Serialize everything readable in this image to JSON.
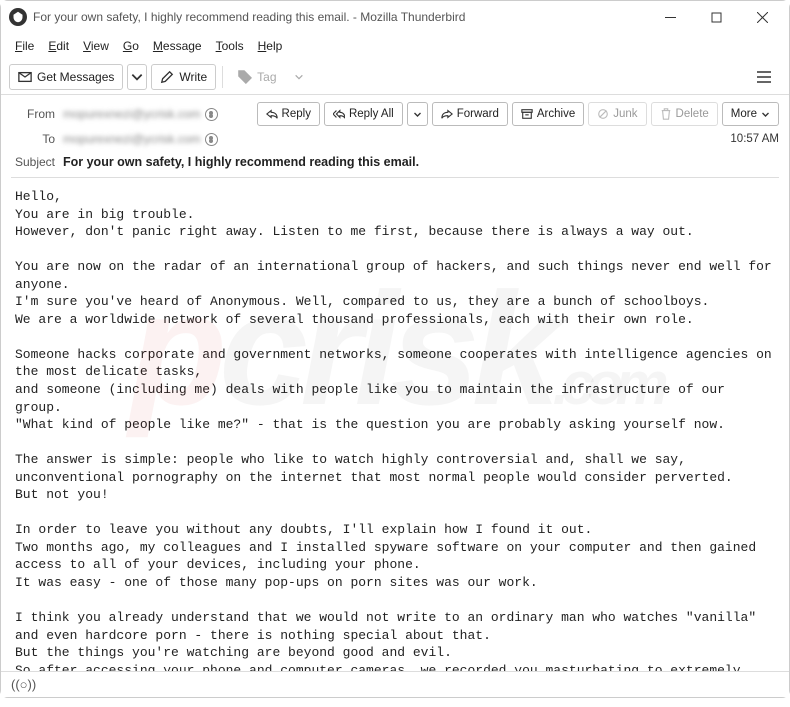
{
  "window": {
    "title": "For your own safety, I highly recommend reading this email. - Mozilla Thunderbird"
  },
  "menu": {
    "file": "File",
    "edit": "Edit",
    "view": "View",
    "go": "Go",
    "message": "Message",
    "tools": "Tools",
    "help": "Help"
  },
  "toolbar": {
    "get_messages": "Get Messages",
    "write": "Write",
    "tag": "Tag"
  },
  "header": {
    "from_label": "From",
    "from_value": "mopurexnezi@ycrisk.com",
    "to_label": "To",
    "to_value": "mopurexnezi@ycrisk.com",
    "subject_label": "Subject",
    "subject_value": "For your own safety, I highly recommend reading this email.",
    "timestamp": "10:57 AM"
  },
  "actions": {
    "reply": "Reply",
    "reply_all": "Reply All",
    "forward": "Forward",
    "archive": "Archive",
    "junk": "Junk",
    "delete": "Delete",
    "more": "More"
  },
  "body_text": "Hello,\nYou are in big trouble.\nHowever, don't panic right away. Listen to me first, because there is always a way out.\n\nYou are now on the radar of an international group of hackers, and such things never end well for anyone.\nI'm sure you've heard of Anonymous. Well, compared to us, they are a bunch of schoolboys.\nWe are a worldwide network of several thousand professionals, each with their own role.\n\nSomeone hacks corporate and government networks, someone cooperates with intelligence agencies on the most delicate tasks,\nand someone (including me) deals with people like you to maintain the infrastructure of our group.\n\"What kind of people like me?\" - that is the question you are probably asking yourself now.\n\nThe answer is simple: people who like to watch highly controversial and, shall we say, unconventional pornography on the internet that most normal people would consider perverted.\nBut not you!\n\nIn order to leave you without any doubts, I'll explain how I found it out.\nTwo months ago, my colleagues and I installed spyware software on your computer and then gained access to all of your devices, including your phone.\nIt was easy - one of those many pop-ups on porn sites was our work.\n\nI think you already understand that we would not write to an ordinary man who watches \"vanilla\" and even hardcore porn - there is nothing special about that.\nBut the things you're watching are beyond good and evil.\nSo after accessing your phone and computer cameras, we recorded you masturbating to extremely controversial videos."
}
